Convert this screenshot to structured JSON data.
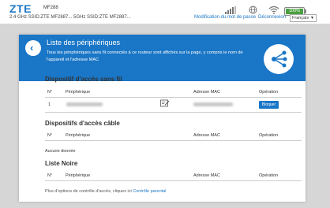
{
  "topbar": {
    "logo": "ZTE",
    "model": "MF288",
    "ssid": "2.4 GHz SSID:ZTE MF2887...  5GHz SSID:ZTE MF2887...",
    "battery": "100%",
    "battery_level": 1.0,
    "nav": {
      "change_password": "Modification du mot de passe",
      "logout": "Déconnexion"
    },
    "language": "Français"
  },
  "header": {
    "title": "Liste des périphériques",
    "description": "Tous les périphériques sans fil connectés à ce routeur sont affichés sur la page, y compris le nom de l'appareil et l'adresse MAC"
  },
  "sections": {
    "wireless": {
      "title": "Dispositif d'accès sans fil",
      "columns": {
        "no": "N°",
        "device": "Périphérique",
        "mac": "Adresse MAC",
        "op": "Opération"
      },
      "rows": [
        {
          "no": "1",
          "action": "Bloquer"
        }
      ]
    },
    "wired": {
      "title": "Dispositifs d'accès câble",
      "columns": {
        "no": "N°",
        "device": "Périphérique",
        "mac": "Adresse MAC",
        "op": "Opération"
      },
      "empty": "Aucune donnée"
    },
    "blacklist": {
      "title": "Liste Noire",
      "columns": {
        "no": "N°",
        "device": "Périphérique",
        "mac": "Adresse MAC",
        "op": "Opération"
      }
    }
  },
  "footer": {
    "text": "Plus d'options de contrôle d'accès, cliquez ici",
    "link": "Contrôle parental"
  },
  "colors": {
    "accent": "#1a76c6",
    "background": "#d6d6d6"
  }
}
